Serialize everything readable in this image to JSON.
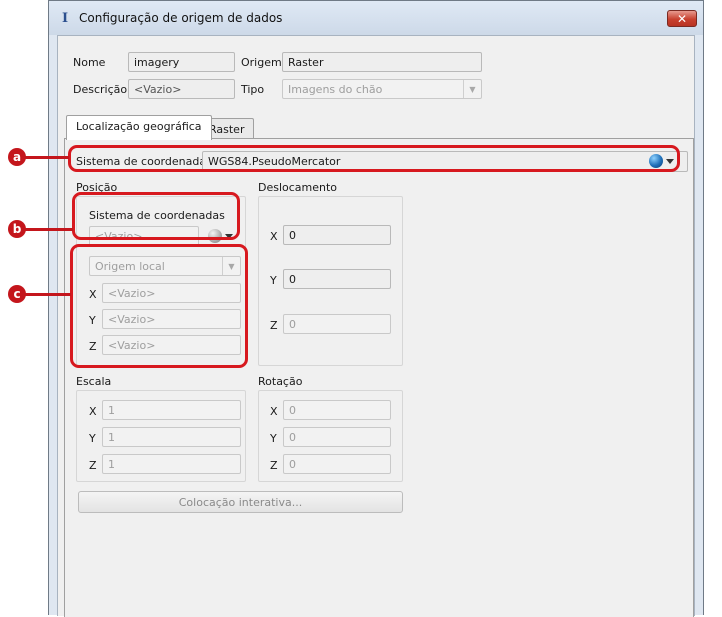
{
  "window": {
    "title": "Configuração de origem de dados",
    "close_glyph": "✕",
    "icon": "I"
  },
  "header": {
    "nome_label": "Nome",
    "nome_value": "imagery",
    "origem_label": "Origem",
    "origem_value": "Raster",
    "descricao_label": "Descrição",
    "descricao_placeholder": "<Vazio>",
    "tipo_label": "Tipo",
    "tipo_value": "Imagens do chão"
  },
  "tabs": [
    {
      "label": "Localização geográfica",
      "active": true
    },
    {
      "label": "Raster",
      "active": false
    }
  ],
  "geo": {
    "crs_label": "Sistema de coordenadas",
    "crs_value": "WGS84.PseudoMercator",
    "posicao_title": "Posição",
    "pos_crs_label": "Sistema de coordenadas",
    "pos_crs_placeholder": "<Vazio>",
    "origem_local": "Origem local",
    "pos_x_label": "X",
    "pos_x": "<Vazio>",
    "pos_y_label": "Y",
    "pos_y": "<Vazio>",
    "pos_z_label": "Z",
    "pos_z": "<Vazio>",
    "deslocamento_title": "Deslocamento",
    "desl_x_label": "X",
    "desl_x": "0",
    "desl_y_label": "Y",
    "desl_y": "0",
    "desl_z_label": "Z",
    "desl_z": "0",
    "escala_title": "Escala",
    "esc_x_label": "X",
    "esc_x": "1",
    "esc_y_label": "Y",
    "esc_y": "1",
    "esc_z_label": "Z",
    "esc_z": "1",
    "rotacao_title": "Rotação",
    "rot_x_label": "X",
    "rot_x": "0",
    "rot_y_label": "Y",
    "rot_y": "0",
    "rot_z_label": "Z",
    "rot_z": "0",
    "colocacao_button": "Colocação interativa..."
  },
  "annotations": {
    "a": "a",
    "b": "b",
    "c": "c",
    "color": "#d7191f"
  },
  "icons": {
    "globe": "globe-icon",
    "dropdown": "chevron-down-icon",
    "close": "close-icon",
    "app": "app-icon"
  }
}
